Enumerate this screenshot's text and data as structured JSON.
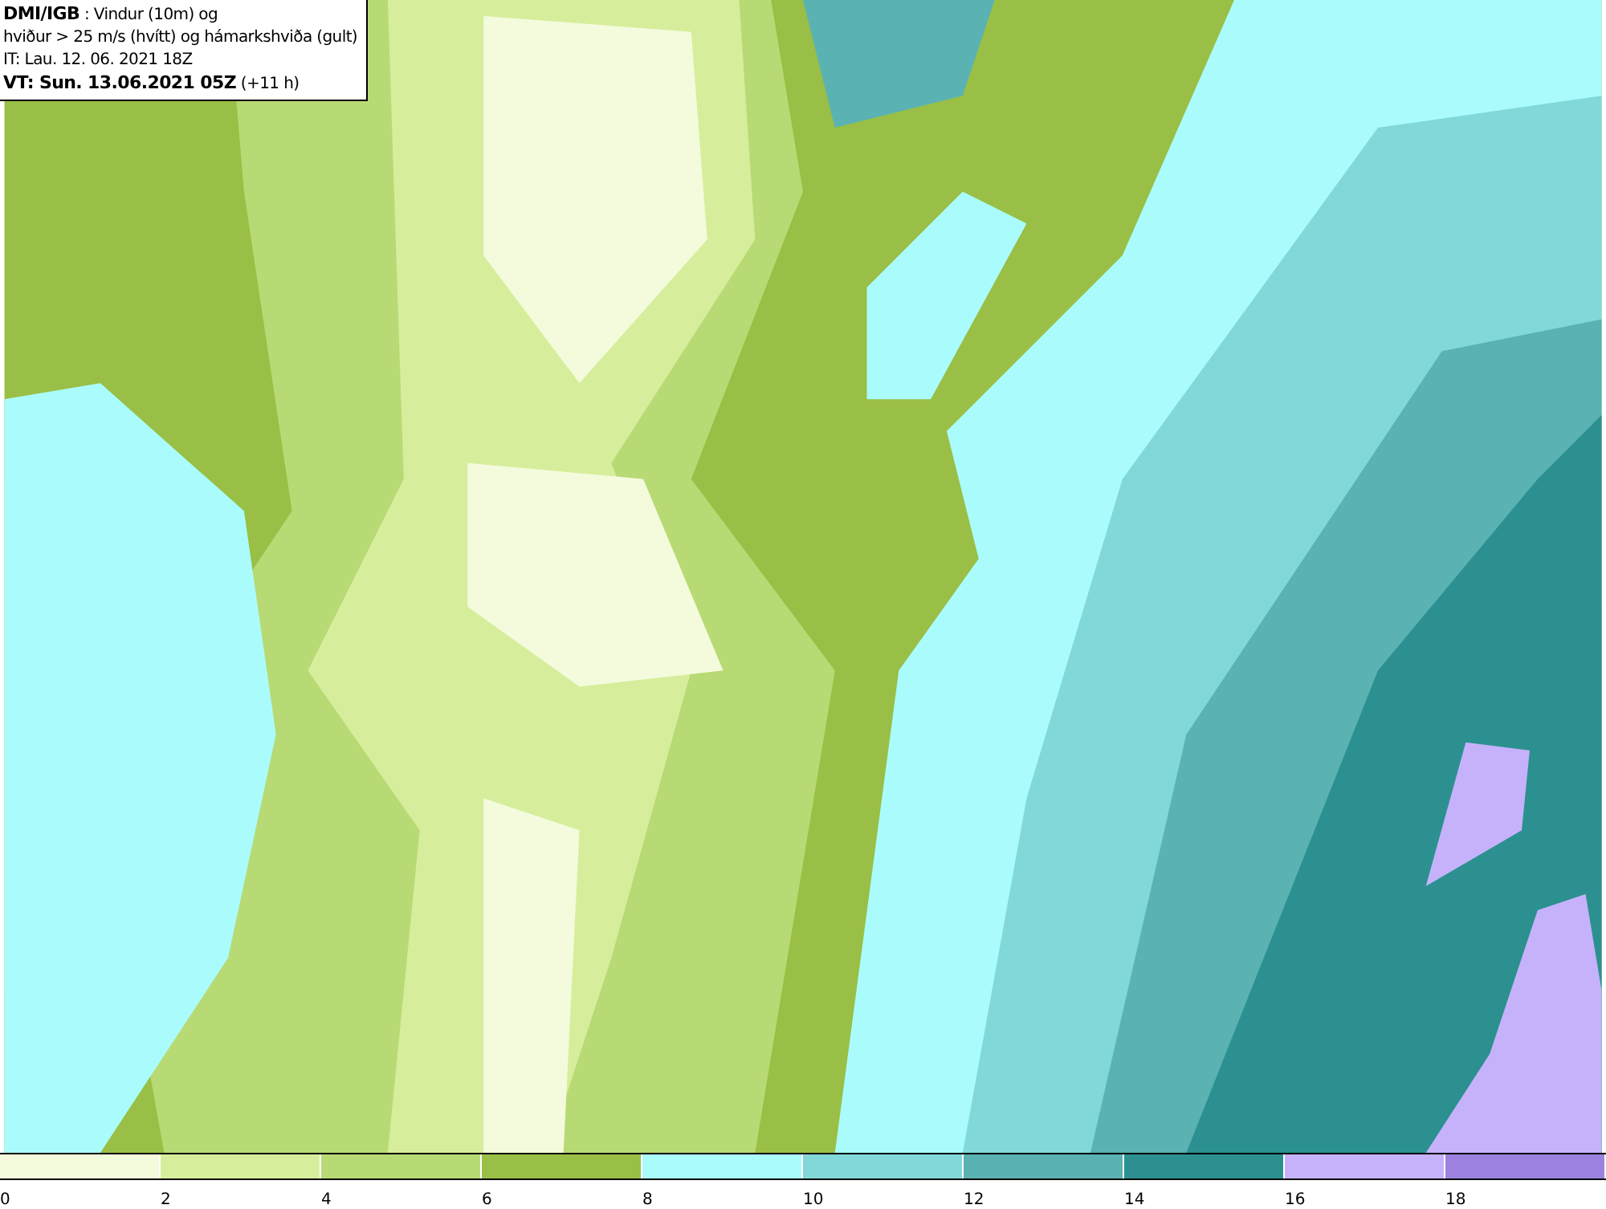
{
  "title_box": {
    "lines": [
      "**DMI/IGB** : Vindur (10m) og",
      "hviður > 25 m/s (hvítt) og hámarkshviða (gult)",
      "IT: Lau. 12. 06. 2021 18Z",
      "**VT: Sun. 13.06.2021 05Z** (+11 h)"
    ]
  },
  "legend": {
    "bins": [
      {
        "color": "#f4fbdc"
      },
      {
        "color": "#d6ee9c"
      },
      {
        "color": "#b8da74"
      },
      {
        "color": "#9abf46"
      },
      {
        "color": "#aafcfc"
      },
      {
        "color": "#82d8d8"
      },
      {
        "color": "#5ab2b2"
      },
      {
        "color": "#2c9090"
      },
      {
        "color": "#c6b2fa"
      },
      {
        "color": "#9c82de"
      }
    ],
    "labels": [
      "0",
      "2",
      "4",
      "6",
      "8",
      "10",
      "12",
      "14",
      "16",
      "18"
    ]
  }
}
